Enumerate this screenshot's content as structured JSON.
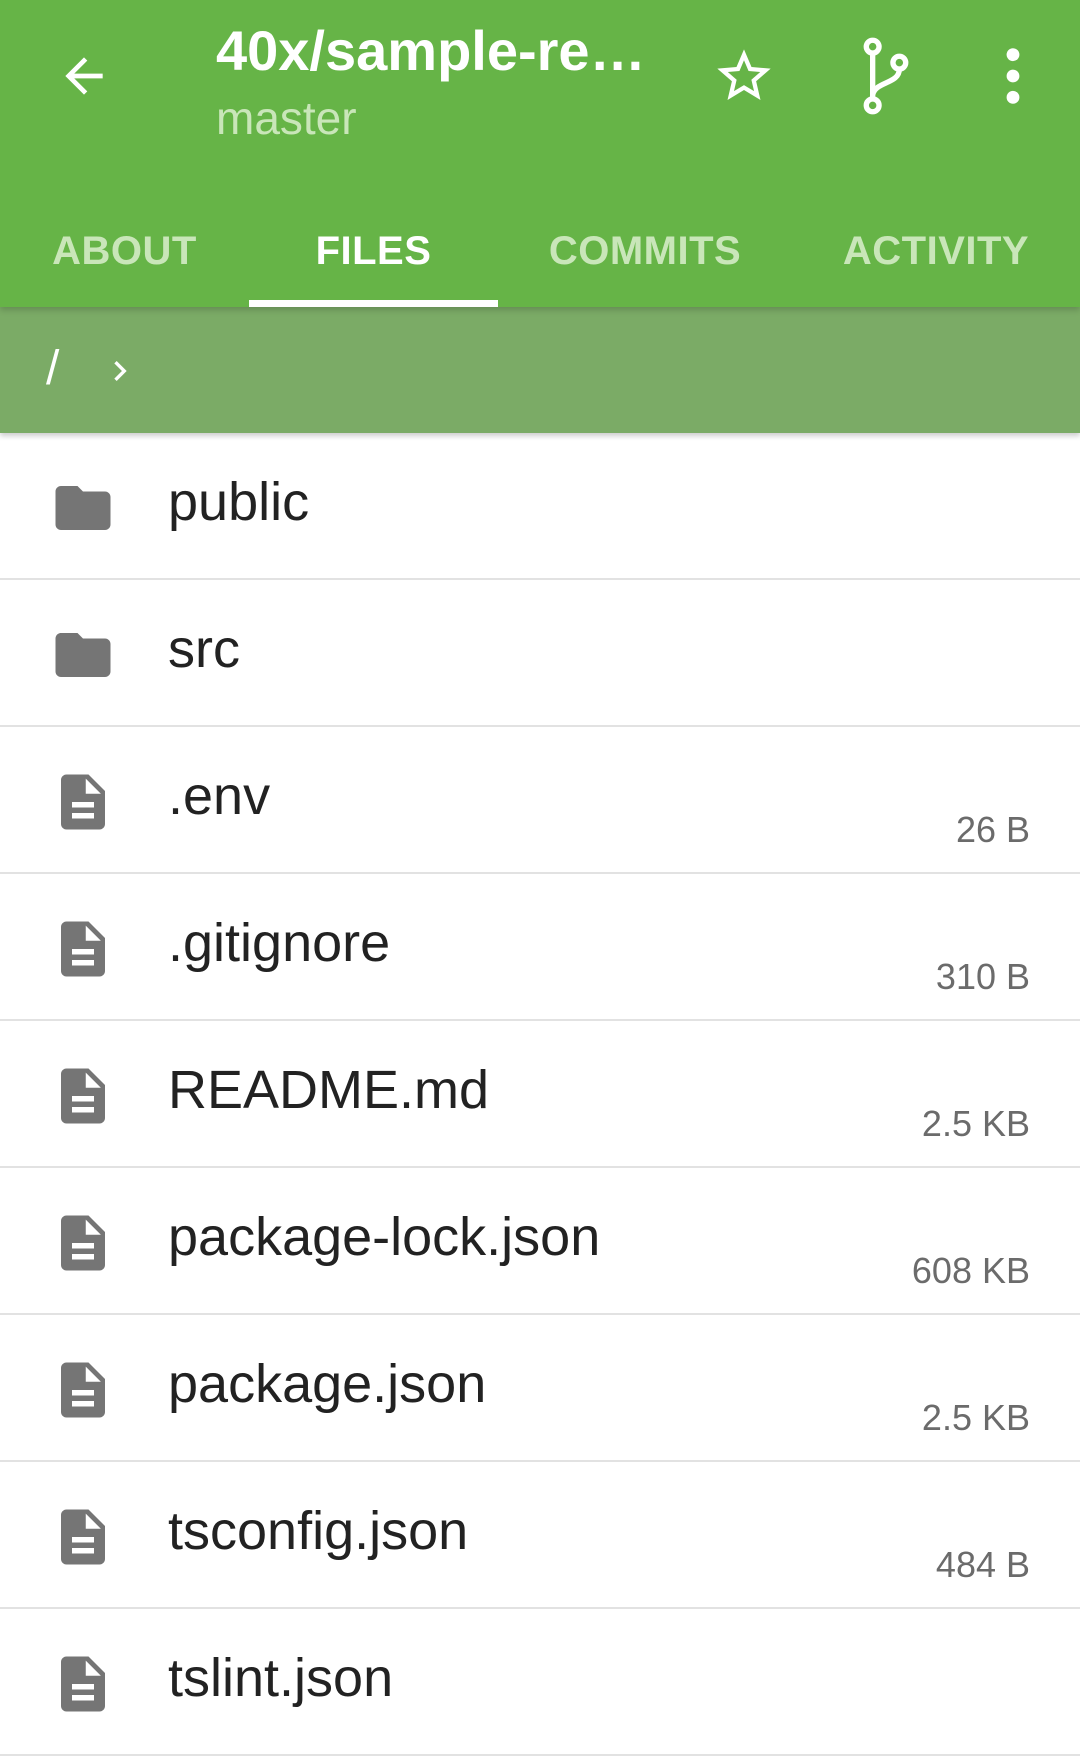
{
  "appbar": {
    "title": "40x/sample-re…",
    "subtitle": "master",
    "back_icon": "arrow-back-icon",
    "actions": [
      "star-icon",
      "branch-icon",
      "more-vert-icon"
    ]
  },
  "tabs": [
    {
      "label": "ABOUT"
    },
    {
      "label": "FILES"
    },
    {
      "label": "COMMITS"
    },
    {
      "label": "ACTIVITY"
    }
  ],
  "active_tab": "FILES",
  "breadcrumb": {
    "root": "/"
  },
  "files": [
    {
      "name": "public",
      "type": "folder",
      "size": ""
    },
    {
      "name": "src",
      "type": "folder",
      "size": ""
    },
    {
      "name": ".env",
      "type": "file",
      "size": "26 B"
    },
    {
      "name": ".gitignore",
      "type": "file",
      "size": "310 B"
    },
    {
      "name": "README.md",
      "type": "file",
      "size": "2.5 KB"
    },
    {
      "name": "package-lock.json",
      "type": "file",
      "size": "608 KB"
    },
    {
      "name": "package.json",
      "type": "file",
      "size": "2.5 KB"
    },
    {
      "name": "tsconfig.json",
      "type": "file",
      "size": "484 B"
    },
    {
      "name": "tslint.json",
      "type": "file",
      "size": ""
    }
  ],
  "colors": {
    "appbar": "#66b447",
    "pathbar": "#7bab66",
    "icon": "#757575"
  }
}
